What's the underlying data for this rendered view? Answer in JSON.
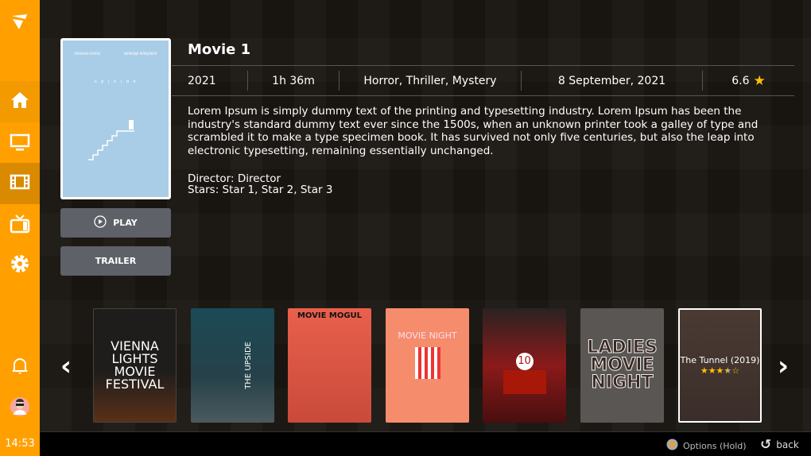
{
  "sidebar": {
    "items": [
      "logo",
      "home",
      "tv",
      "movies",
      "live-tv",
      "settings",
      "notifications",
      "profile"
    ],
    "accent": "#FFA000",
    "clock": "14:53"
  },
  "movie": {
    "title": "Movie 1",
    "year": "2021",
    "duration": "1h 36m",
    "genres": "Horror, Thriller, Mystery",
    "release_date": "8 September, 2021",
    "rating": "6.6",
    "description": "Lorem Ipsum is simply dummy text of the printing and typesetting industry. Lorem Ipsum has been the industry's standard dummy text ever since the 1500s, when an unknown printer took a galley of type and scrambled it to make a type specimen book. It has survived not only five centuries, but also the leap into electronic typesetting, remaining essentially unchanged.",
    "director": "Director: Director",
    "stars": "Stars: Star 1, Star 2, Star 3",
    "poster": {
      "laurel1": "DRAGAN GAVRIC",
      "laurel2": "NEMANJA MARJANOV",
      "title": "u p  | s |  d e"
    }
  },
  "buttons": {
    "play": "PLAY",
    "trailer": "TRAILER"
  },
  "carousel": [
    {
      "text": "VIENNA LIGHTS MOVIE FESTIVAL"
    },
    {
      "text": "THE UPSIDE"
    },
    {
      "text": "MOVIE MOGUL"
    },
    {
      "text": "MOVIE NIGHT"
    },
    {
      "text": "10"
    },
    {
      "text": "LADIES MOVIE NIGHT"
    },
    {
      "text": "The Tunnel (2019)",
      "rating_stars": 3.5
    }
  ],
  "footer": {
    "options": "Options (Hold)",
    "back": "back"
  }
}
